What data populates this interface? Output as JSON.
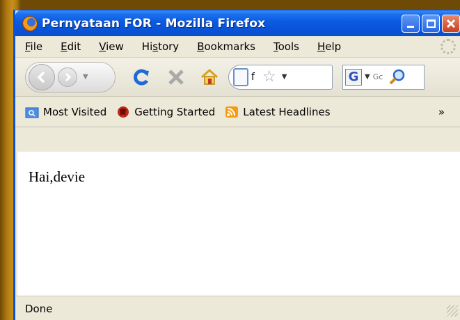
{
  "window": {
    "title": "Pernyataan FOR - Mozilla Firefox"
  },
  "menubar": {
    "items": [
      {
        "pre": "",
        "ul": "F",
        "post": "ile"
      },
      {
        "pre": "",
        "ul": "E",
        "post": "dit"
      },
      {
        "pre": "",
        "ul": "V",
        "post": "iew"
      },
      {
        "pre": "Hi",
        "ul": "s",
        "post": "tory"
      },
      {
        "pre": "",
        "ul": "B",
        "post": "ookmarks"
      },
      {
        "pre": "",
        "ul": "T",
        "post": "ools"
      },
      {
        "pre": "",
        "ul": "H",
        "post": "elp"
      }
    ]
  },
  "navbar": {
    "url_text": "f",
    "search_placeholder": "Gc"
  },
  "bookmarks": {
    "items": [
      "Most Visited",
      "Getting Started",
      "Latest Headlines"
    ],
    "overflow": "»"
  },
  "content": {
    "text": "Hai,devie"
  },
  "status": {
    "text": "Done"
  },
  "colors": {
    "titlebar": "#0a5ae0",
    "chrome": "#ece9d8",
    "close_button": "#c8401f"
  }
}
